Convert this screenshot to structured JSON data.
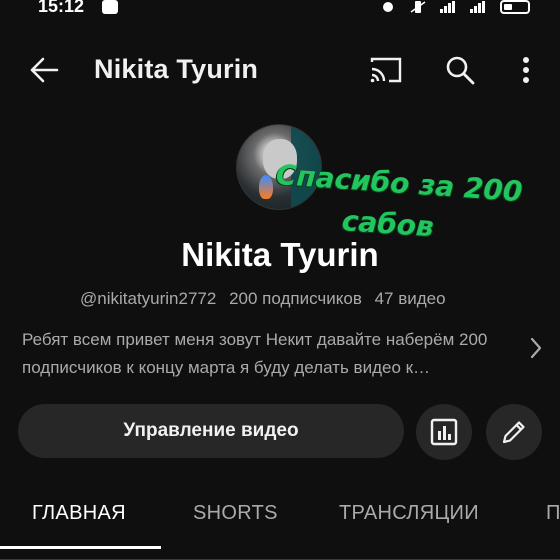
{
  "status_bar": {
    "time": "15:12",
    "icons": [
      "notification-icon",
      "alarm-icon",
      "vibrate-icon",
      "signal-icon",
      "signal-icon",
      "battery-icon"
    ]
  },
  "app_bar": {
    "title": "Nikita Tyurin",
    "icons": [
      "back-arrow-icon",
      "cast-icon",
      "search-icon",
      "more-vert-icon"
    ]
  },
  "channel": {
    "overlay_line1": "Спасибо за 200",
    "overlay_line2": "сабов",
    "name": "Nikita Tyurin",
    "handle": "@nikitatyurin2772",
    "subscribers": "200 подписчиков",
    "videos": "47 видео",
    "description": "Ребят всем привет меня зовут Некит давайте наберём 200 подписчиков к концу марта я буду делать видео к…"
  },
  "actions": {
    "manage_label": "Управление видео",
    "stats_icon": "analytics-icon",
    "edit_icon": "pencil-icon"
  },
  "tabs": {
    "items": [
      "ГЛАВНАЯ",
      "SHORTS",
      "ТРАНСЛЯЦИИ",
      "П"
    ],
    "active": "ГЛАВНАЯ"
  },
  "colors": {
    "background": "#0f0f0f",
    "overlay_text": "#22c55e",
    "button_bg": "#272727",
    "secondary_text": "#aaaaaa"
  }
}
